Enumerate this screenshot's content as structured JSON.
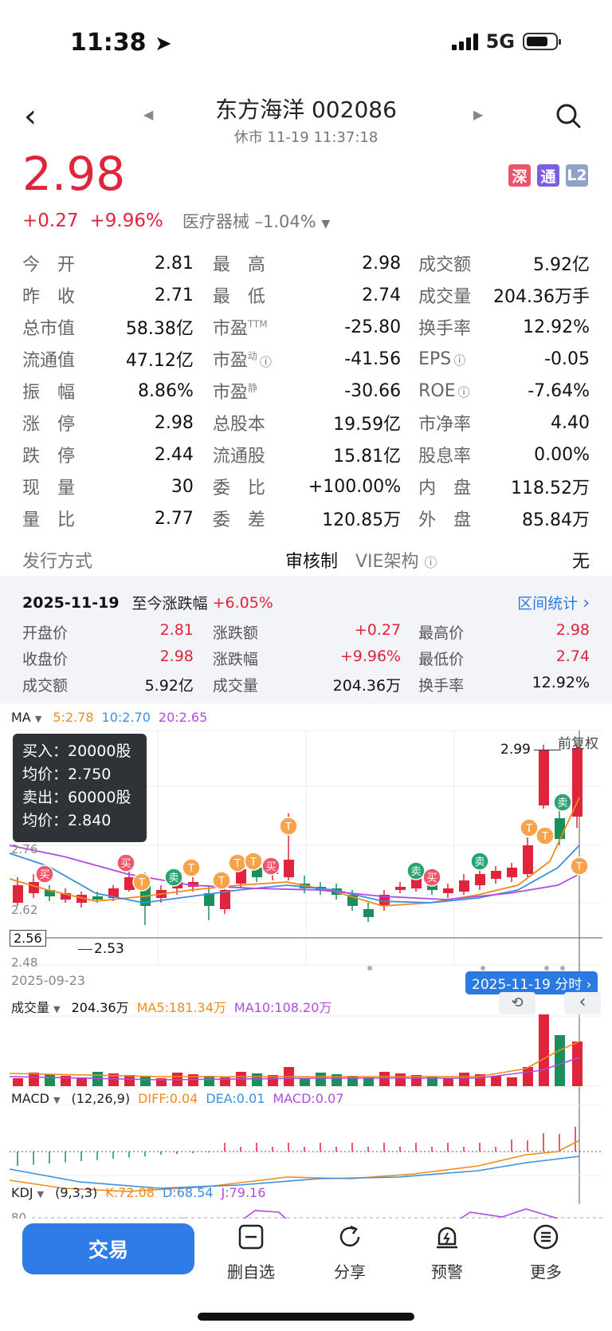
{
  "status": {
    "time": "11:38",
    "network": "5G"
  },
  "header": {
    "title": "东方海洋 002086",
    "subtitle": "休市 11-19 11:37:18"
  },
  "price": {
    "current": "2.98",
    "change": "+0.27",
    "change_pct": "+9.96%",
    "industry": "医疗器械",
    "industry_change": "–1.04%",
    "badges": [
      {
        "label": "深",
        "color": "#e8546c"
      },
      {
        "label": "通",
        "color": "#7b5fe0"
      },
      {
        "label": "L2",
        "color": "#8ea3c7"
      }
    ]
  },
  "quote": {
    "rows": [
      [
        {
          "label": "今　开",
          "value": "2.81",
          "color": "red"
        },
        {
          "label": "最　高",
          "value": "2.98",
          "color": "red"
        },
        {
          "label": "成交额",
          "value": "5.92亿",
          "color": ""
        }
      ],
      [
        {
          "label": "昨　收",
          "value": "2.71",
          "color": ""
        },
        {
          "label": "最　低",
          "value": "2.74",
          "color": "red"
        },
        {
          "label": "成交量",
          "value": "204.36万手",
          "color": ""
        }
      ],
      [
        {
          "label": "总市值",
          "value": "58.38亿",
          "color": ""
        },
        {
          "label": "市盈",
          "sup": "TTM",
          "value": "-25.80",
          "color": ""
        },
        {
          "label": "换手率",
          "value": "12.92%",
          "color": ""
        }
      ],
      [
        {
          "label": "流通值",
          "value": "47.12亿",
          "color": ""
        },
        {
          "label": "市盈",
          "sup": "动",
          "info": true,
          "value": "-41.56",
          "color": ""
        },
        {
          "label": "EPS",
          "info": true,
          "value": "-0.05",
          "color": ""
        }
      ],
      [
        {
          "label": "振　幅",
          "value": "8.86%",
          "color": ""
        },
        {
          "label": "市盈",
          "sup": "静",
          "value": "-30.66",
          "color": ""
        },
        {
          "label": "ROE",
          "info": true,
          "value": "-7.64%",
          "color": ""
        }
      ],
      [
        {
          "label": "涨　停",
          "value": "2.98",
          "color": "red"
        },
        {
          "label": "总股本",
          "value": "19.59亿",
          "color": ""
        },
        {
          "label": "市净率",
          "value": "4.40",
          "color": ""
        }
      ],
      [
        {
          "label": "跌　停",
          "value": "2.44",
          "color": "green"
        },
        {
          "label": "流通股",
          "value": "15.81亿",
          "color": ""
        },
        {
          "label": "股息率",
          "value": "0.00%",
          "color": ""
        }
      ],
      [
        {
          "label": "现　量",
          "value": "30",
          "color": ""
        },
        {
          "label": "委　比",
          "value": "+100.00%",
          "color": "red"
        },
        {
          "label": "内　盘",
          "value": "118.52万",
          "color": "green"
        }
      ],
      [
        {
          "label": "量　比",
          "value": "2.77",
          "color": ""
        },
        {
          "label": "委　差",
          "value": "120.85万",
          "color": "red"
        },
        {
          "label": "外　盘",
          "value": "85.84万",
          "color": "red"
        }
      ]
    ],
    "issue_label": "发行方式",
    "issue_value": "审核制",
    "vie_label": "VIE架构",
    "vie_value": "无"
  },
  "period": {
    "date": "2025-11-19",
    "range_label": "至今涨跌幅",
    "range_value": "+6.05%",
    "stats_link": "区间统计",
    "rows": [
      [
        {
          "label": "开盘价",
          "value": "2.81",
          "color": "red"
        },
        {
          "label": "涨跌额",
          "value": "+0.27",
          "color": "red"
        },
        {
          "label": "最高价",
          "value": "2.98",
          "color": "red"
        }
      ],
      [
        {
          "label": "收盘价",
          "value": "2.98",
          "color": "red"
        },
        {
          "label": "涨跌幅",
          "value": "+9.96%",
          "color": "red"
        },
        {
          "label": "最低价",
          "value": "2.74",
          "color": "red"
        }
      ],
      [
        {
          "label": "成交额",
          "value": "5.92亿",
          "color": ""
        },
        {
          "label": "成交量",
          "value": "204.36万",
          "color": ""
        },
        {
          "label": "换手率",
          "value": "12.92%",
          "color": ""
        }
      ]
    ]
  },
  "kline": {
    "selector": "MA",
    "ma5": "5:2.78",
    "ma10": "10:2.70",
    "ma20": "20:2.65",
    "adjust": "前复权",
    "high_label": "2.99",
    "low_label": "2.53",
    "y_ticks": [
      "2.76",
      "2.62",
      "2.56",
      "2.48"
    ],
    "start_date": "2025-09-23",
    "cursor_date": "2025-11-19 分时",
    "tooltip": {
      "buy": "买入：20000股",
      "buy_avg": "均价：2.750",
      "sell": "卖出：60000股",
      "sell_avg": "均价：2.840"
    },
    "marker_labels": {
      "buy": "买",
      "sell": "卖",
      "t": "T"
    }
  },
  "volume": {
    "selector": "成交量",
    "value": "204.36万",
    "ma5": "MA5:181.34万",
    "ma10": "MA10:108.20万"
  },
  "macd": {
    "selector": "MACD",
    "params": "(12,26,9)",
    "diff": "DIFF:0.04",
    "dea": "DEA:0.01",
    "macd": "MACD:0.07"
  },
  "kdj": {
    "selector": "KDJ",
    "params": "(9,3,3)",
    "k": "K:72.08",
    "d": "D:68.54",
    "j": "J:79.16",
    "level": "80"
  },
  "tabbar": {
    "trade": "交易",
    "items": [
      "删自选",
      "分享",
      "预警",
      "更多"
    ]
  },
  "colors": {
    "up": "#e0243b",
    "down": "#1a8f5a",
    "ma5": "#f08a1c",
    "ma10": "#3b8fe0",
    "ma20": "#b14be0",
    "accent": "#2a7ae2"
  }
}
